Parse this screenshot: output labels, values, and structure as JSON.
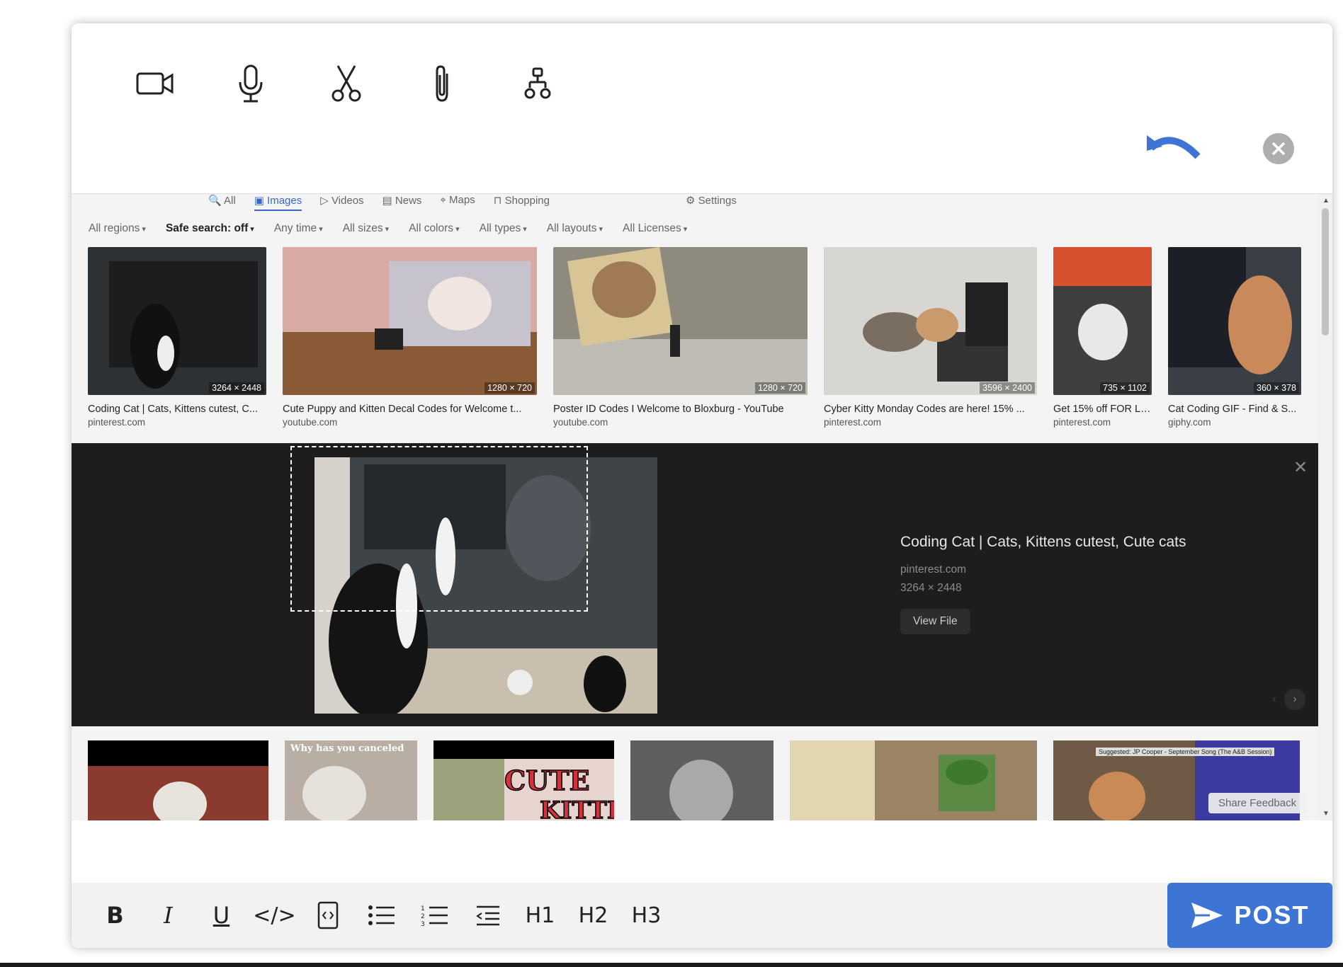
{
  "toolbar_icons": [
    "video-camera-icon",
    "microphone-icon",
    "scissors-icon",
    "paperclip-icon",
    "hierarchy-icon"
  ],
  "search": {
    "tabs": [
      "All",
      "Images",
      "Videos",
      "News",
      "Maps",
      "Shopping"
    ],
    "active_tab": "Images",
    "settings_label": "Settings",
    "filters": [
      "All regions",
      "Safe search: off",
      "Any time",
      "All sizes",
      "All colors",
      "All types",
      "All layouts",
      "All Licenses"
    ]
  },
  "results": [
    {
      "title": "Coding Cat | Cats, Kittens cutest, C...",
      "source": "pinterest.com",
      "dims": "3264 × 2448",
      "color": "#2e3134"
    },
    {
      "title": "Cute Puppy and Kitten Decal Codes for Welcome t...",
      "source": "youtube.com",
      "dims": "1280 × 720",
      "color": "#c89a8d"
    },
    {
      "title": "Poster ID Codes I Welcome to Bloxburg - YouTube",
      "source": "youtube.com",
      "dims": "1280 × 720",
      "color": "#8e8a7d"
    },
    {
      "title": "Cyber Kitty Monday Codes are here! 15% ...",
      "source": "pinterest.com",
      "dims": "3596 × 2400",
      "color": "#d8d6d2"
    },
    {
      "title": "Get 15% off FOR LI...",
      "source": "pinterest.com",
      "dims": "735 × 1102",
      "color": "#3f3f3f"
    },
    {
      "title": "Cat Coding GIF - Find & S...",
      "source": "giphy.com",
      "dims": "360 × 378",
      "color": "#3a3f45"
    }
  ],
  "preview": {
    "title": "Coding Cat | Cats, Kittens cutest, Cute cats",
    "source": "pinterest.com",
    "dims": "3264 × 2448",
    "view_file": "View File"
  },
  "results_row2": [
    {
      "caption": "",
      "color": "#8a3a2f"
    },
    {
      "caption": "Why has you canceled",
      "color": "#b8aea3"
    },
    {
      "caption": "CUTE KITTEN",
      "color": "#e8d4cf"
    },
    {
      "caption": "",
      "color": "#5f5f5f"
    },
    {
      "caption": "",
      "color": "#9b8466"
    },
    {
      "caption": "Suggested: JP Cooper - September Song (The A&B Session)",
      "color": "#6f5a45"
    }
  ],
  "share_feedback": "Share Feedback",
  "format_buttons": [
    "B",
    "I",
    "U",
    "</>",
    "code-block-icon",
    "bullet-list-icon",
    "numbered-list-icon",
    "outdent-icon",
    "H1",
    "H2",
    "H3"
  ],
  "post_label": "POST",
  "colors": {
    "accent": "#3e74d4",
    "preview_bg": "#1d1d1e"
  }
}
